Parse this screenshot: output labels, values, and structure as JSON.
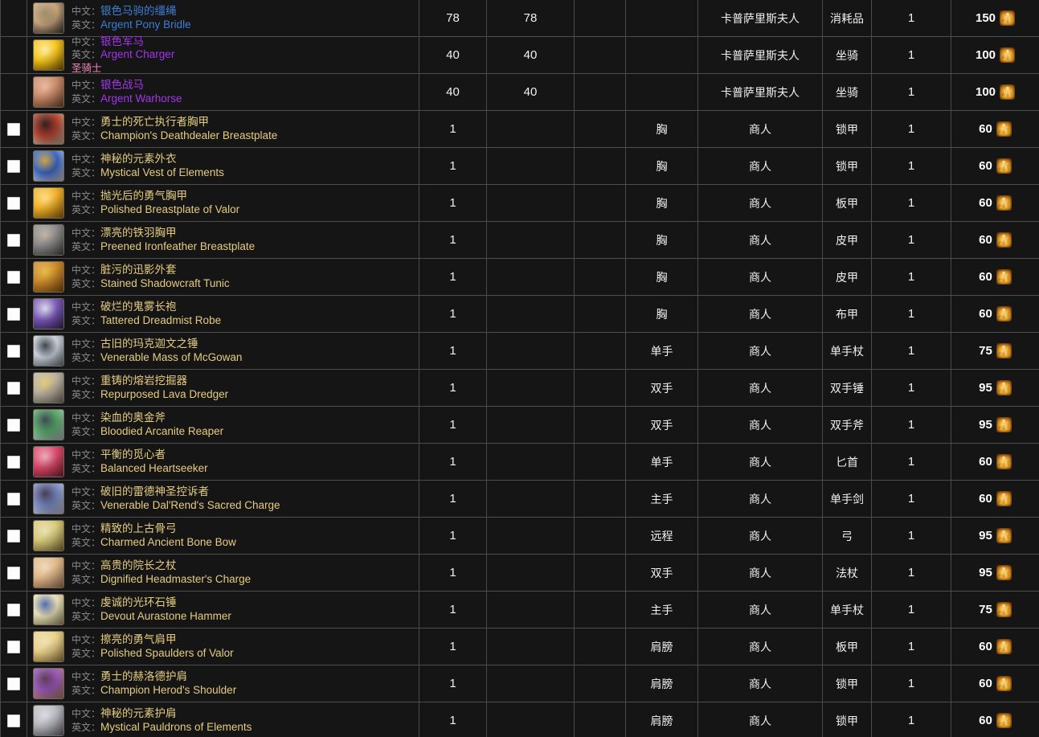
{
  "table": {
    "labels": {
      "cn": "中文：",
      "en": "英文："
    },
    "rows": [
      {
        "checkbox": false,
        "quality": "rare",
        "icon": "argent-pony-bridle-icon",
        "icon_colors": [
          "#c8a47a",
          "#3a3a3a",
          "#9a8a6a"
        ],
        "name_cn": "银色马驹的缰绳",
        "name_en": "Argent Pony Bridle",
        "class_req": "",
        "level": "78",
        "req_level": "78",
        "slot_small": "",
        "slot": "",
        "source": "卡普萨里斯夫人",
        "type": "消耗品",
        "qty": "1",
        "cost": "150"
      },
      {
        "checkbox": false,
        "quality": "epic",
        "icon": "argent-charger-icon",
        "icon_colors": [
          "#f5c518",
          "#8a5a05",
          "#ffe9a0"
        ],
        "name_cn": "银色军马",
        "name_en": "Argent Charger",
        "class_req": "圣骑士",
        "level": "40",
        "req_level": "40",
        "slot_small": "",
        "slot": "",
        "source": "卡普萨里斯夫人",
        "type": "坐骑",
        "qty": "1",
        "cost": "100"
      },
      {
        "checkbox": false,
        "quality": "epic",
        "icon": "argent-warhorse-icon",
        "icon_colors": [
          "#c98a6a",
          "#7a4a2a",
          "#e8b79a"
        ],
        "name_cn": "银色战马",
        "name_en": "Argent Warhorse",
        "class_req": "",
        "level": "40",
        "req_level": "40",
        "slot_small": "",
        "slot": "",
        "source": "卡普萨里斯夫人",
        "type": "坐骑",
        "qty": "1",
        "cost": "100"
      },
      {
        "checkbox": true,
        "quality": "uncommon",
        "icon": "champions-deathdealer-breastplate-icon",
        "icon_colors": [
          "#b04030",
          "#d8c0a0",
          "#2a1a18"
        ],
        "name_cn": "勇士的死亡执行者胸甲",
        "name_en": "Champion's Deathdealer Breastplate",
        "class_req": "",
        "level": "1",
        "req_level": "",
        "slot_small": "",
        "slot": "胸",
        "source": "商人",
        "type": "锁甲",
        "qty": "1",
        "cost": "60"
      },
      {
        "checkbox": true,
        "quality": "uncommon",
        "icon": "mystical-vest-of-elements-icon",
        "icon_colors": [
          "#3a64c0",
          "#d8d8e8",
          "#c8a040"
        ],
        "name_cn": "神秘的元素外衣",
        "name_en": "Mystical Vest of Elements",
        "class_req": "",
        "level": "1",
        "req_level": "",
        "slot_small": "",
        "slot": "胸",
        "source": "商人",
        "type": "锁甲",
        "qty": "1",
        "cost": "60"
      },
      {
        "checkbox": true,
        "quality": "uncommon",
        "icon": "polished-breastplate-of-valor-icon",
        "icon_colors": [
          "#f0b028",
          "#a06808",
          "#ffdc80"
        ],
        "name_cn": "抛光后的勇气胸甲",
        "name_en": "Polished Breastplate of Valor",
        "class_req": "",
        "level": "1",
        "req_level": "",
        "slot_small": "",
        "slot": "胸",
        "source": "商人",
        "type": "板甲",
        "qty": "1",
        "cost": "60"
      },
      {
        "checkbox": true,
        "quality": "uncommon",
        "icon": "preened-ironfeather-breastplate-icon",
        "icon_colors": [
          "#8a8a8a",
          "#4a4a4a",
          "#c0b0a0"
        ],
        "name_cn": "漂亮的铁羽胸甲",
        "name_en": "Preened Ironfeather Breastplate",
        "class_req": "",
        "level": "1",
        "req_level": "",
        "slot_small": "",
        "slot": "胸",
        "source": "商人",
        "type": "皮甲",
        "qty": "1",
        "cost": "60"
      },
      {
        "checkbox": true,
        "quality": "uncommon",
        "icon": "stained-shadowcraft-tunic-icon",
        "icon_colors": [
          "#c88828",
          "#8a5010",
          "#e8b848"
        ],
        "name_cn": "脏污的迅影外套",
        "name_en": "Stained Shadowcraft Tunic",
        "class_req": "",
        "level": "1",
        "req_level": "",
        "slot_small": "",
        "slot": "胸",
        "source": "商人",
        "type": "皮甲",
        "qty": "1",
        "cost": "60"
      },
      {
        "checkbox": true,
        "quality": "uncommon",
        "icon": "tattered-dreadmist-robe-icon",
        "icon_colors": [
          "#7a58b8",
          "#3a2a58",
          "#d8d8e8"
        ],
        "name_cn": "破烂的鬼雾长袍",
        "name_en": "Tattered Dreadmist Robe",
        "class_req": "",
        "level": "1",
        "req_level": "",
        "slot_small": "",
        "slot": "胸",
        "source": "商人",
        "type": "布甲",
        "qty": "1",
        "cost": "60"
      },
      {
        "checkbox": true,
        "quality": "uncommon",
        "icon": "venerable-mass-of-mcgowan-icon",
        "icon_colors": [
          "#c8d0d8",
          "#6a7480",
          "#3a4048"
        ],
        "name_cn": "古旧的玛克迦文之锤",
        "name_en": "Venerable Mass of McGowan",
        "class_req": "",
        "level": "1",
        "req_level": "",
        "slot_small": "",
        "slot": "单手",
        "source": "商人",
        "type": "单手杖",
        "qty": "1",
        "cost": "75"
      },
      {
        "checkbox": true,
        "quality": "uncommon",
        "icon": "repurposed-lava-dredger-icon",
        "icon_colors": [
          "#b8b0a0",
          "#7a7268",
          "#e0c878"
        ],
        "name_cn": "重铸的熔岩挖掘器",
        "name_en": "Repurposed Lava Dredger",
        "class_req": "",
        "level": "1",
        "req_level": "",
        "slot_small": "",
        "slot": "双手",
        "source": "商人",
        "type": "双手锤",
        "qty": "1",
        "cost": "95"
      },
      {
        "checkbox": true,
        "quality": "uncommon",
        "icon": "bloodied-arcanite-reaper-icon",
        "icon_colors": [
          "#58a868",
          "#c0c8d0",
          "#3a4450"
        ],
        "name_cn": "染血的奥金斧",
        "name_en": "Bloodied Arcanite Reaper",
        "class_req": "",
        "level": "1",
        "req_level": "",
        "slot_small": "",
        "slot": "双手",
        "source": "商人",
        "type": "双手斧",
        "qty": "1",
        "cost": "95"
      },
      {
        "checkbox": true,
        "quality": "uncommon",
        "icon": "balanced-heartseeker-icon",
        "icon_colors": [
          "#d84868",
          "#8a2038",
          "#e8a8b8"
        ],
        "name_cn": "平衡的觅心者",
        "name_en": "Balanced Heartseeker",
        "class_req": "",
        "level": "1",
        "req_level": "",
        "slot_small": "",
        "slot": "单手",
        "source": "商人",
        "type": "匕首",
        "qty": "1",
        "cost": "60"
      },
      {
        "checkbox": true,
        "quality": "uncommon",
        "icon": "venerable-dalrends-sacred-charge-icon",
        "icon_colors": [
          "#7888c0",
          "#c8d0e0",
          "#403850"
        ],
        "name_cn": "破旧的雷德神圣控诉者",
        "name_en": "Venerable Dal'Rend's Sacred Charge",
        "class_req": "",
        "level": "1",
        "req_level": "",
        "slot_small": "",
        "slot": "主手",
        "source": "商人",
        "type": "单手剑",
        "qty": "1",
        "cost": "60"
      },
      {
        "checkbox": true,
        "quality": "uncommon",
        "icon": "charmed-ancient-bone-bow-icon",
        "icon_colors": [
          "#d8c878",
          "#8a7838",
          "#e8e0b0"
        ],
        "name_cn": "精致的上古骨弓",
        "name_en": "Charmed Ancient Bone Bow",
        "class_req": "",
        "level": "1",
        "req_level": "",
        "slot_small": "",
        "slot": "远程",
        "source": "商人",
        "type": "弓",
        "qty": "1",
        "cost": "95"
      },
      {
        "checkbox": true,
        "quality": "uncommon",
        "icon": "dignified-headmasters-charge-icon",
        "icon_colors": [
          "#e0b888",
          "#a87858",
          "#f0d8b8"
        ],
        "name_cn": "高贵的院长之杖",
        "name_en": "Dignified Headmaster's Charge",
        "class_req": "",
        "level": "1",
        "req_level": "",
        "slot_small": "",
        "slot": "双手",
        "source": "商人",
        "type": "法杖",
        "qty": "1",
        "cost": "95"
      },
      {
        "checkbox": true,
        "quality": "uncommon",
        "icon": "devout-aurastone-hammer-icon",
        "icon_colors": [
          "#e8e0b8",
          "#a09868",
          "#5068a8"
        ],
        "name_cn": "虔诚的光环石锤",
        "name_en": "Devout Aurastone Hammer",
        "class_req": "",
        "level": "1",
        "req_level": "",
        "slot_small": "",
        "slot": "主手",
        "source": "商人",
        "type": "单手杖",
        "qty": "1",
        "cost": "75"
      },
      {
        "checkbox": true,
        "quality": "uncommon",
        "icon": "polished-spaulders-of-valor-icon",
        "icon_colors": [
          "#e8d088",
          "#a08038",
          "#f0e0b0"
        ],
        "name_cn": "擦亮的勇气肩甲",
        "name_en": "Polished Spaulders of Valor",
        "class_req": "",
        "level": "1",
        "req_level": "",
        "slot_small": "",
        "slot": "肩膀",
        "source": "商人",
        "type": "板甲",
        "qty": "1",
        "cost": "60"
      },
      {
        "checkbox": true,
        "quality": "uncommon",
        "icon": "champion-herods-shoulder-icon",
        "icon_colors": [
          "#9858b8",
          "#c08860",
          "#5a3850"
        ],
        "name_cn": "勇士的赫洛德护肩",
        "name_en": "Champion Herod's Shoulder",
        "class_req": "",
        "level": "1",
        "req_level": "",
        "slot_small": "",
        "slot": "肩膀",
        "source": "商人",
        "type": "锁甲",
        "qty": "1",
        "cost": "60"
      },
      {
        "checkbox": true,
        "quality": "uncommon",
        "icon": "mystical-pauldrons-of-elements-icon",
        "icon_colors": [
          "#b8b8c0",
          "#686870",
          "#d8d8e0"
        ],
        "name_cn": "神秘的元素护肩",
        "name_en": "Mystical Pauldrons of Elements",
        "class_req": "",
        "level": "1",
        "req_level": "",
        "slot_small": "",
        "slot": "肩膀",
        "source": "商人",
        "type": "锁甲",
        "qty": "1",
        "cost": "60"
      }
    ]
  },
  "colors": {
    "rare": "#3c7fd4",
    "epic": "#a335ee",
    "uncommon": "#e5cc80",
    "paladin": "#f58cba",
    "grid": "#4a4a4a",
    "background": "#151515"
  }
}
